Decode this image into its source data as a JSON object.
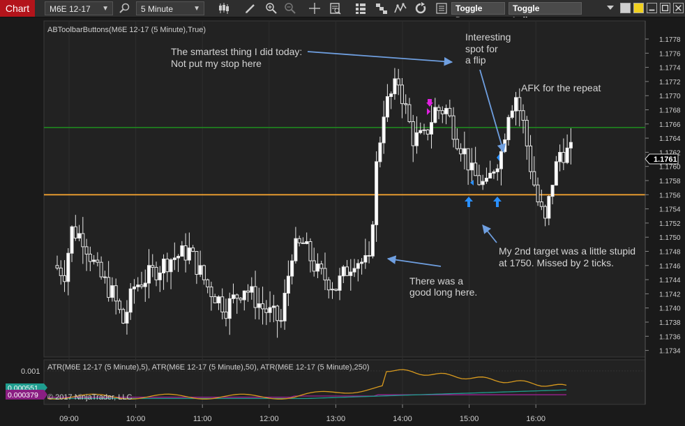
{
  "toolbar": {
    "chart_tab": "Chart",
    "instrument": "M6E 12-17",
    "interval": "5 Minute",
    "toggle_draw": "Toggle Draw",
    "toggle_indicators": "Toggle Indicators"
  },
  "chart": {
    "indicator_label": "ABToolbarButtons(M6E 12-17 (5 Minute),True)",
    "atr_label": "ATR(M6E 12-17 (5 Minute),5), ATR(M6E 12-17 (5 Minute),50), ATR(M6E 12-17 (5 Minute),250)",
    "copyright": "© 2017 NinjaTrader, LLC",
    "current_price": "1.1761",
    "atr_axis_label": "0.001",
    "atr_badge_1": "0.000551",
    "atr_badge_2": "0.000379",
    "price_ticks": [
      "1.1778",
      "1.1776",
      "1.1774",
      "1.1772",
      "1.1770",
      "1.1768",
      "1.1766",
      "1.1764",
      "1.1762",
      "1.1760",
      "1.1758",
      "1.1756",
      "1.1754",
      "1.1752",
      "1.1750",
      "1.1748",
      "1.1746",
      "1.1744",
      "1.1742",
      "1.1740",
      "1.1738",
      "1.1736",
      "1.1734"
    ],
    "time_ticks": [
      "09:00",
      "10:00",
      "11:00",
      "12:00",
      "13:00",
      "14:00",
      "15:00",
      "16:00"
    ],
    "green_line_price": 1.17655,
    "orange_line_price": 1.1756,
    "annotations": {
      "smartest_1": "The smartest thing I did today:",
      "smartest_2": "Not put my stop here",
      "interesting_1": "Interesting",
      "interesting_2": "spot for",
      "interesting_3": "a flip",
      "afk": "AFK for the repeat",
      "target_1": "My 2nd target was a little stupid",
      "target_2": "at 1750. Missed by 2 ticks.",
      "long_1": "There was a",
      "long_2": "good long here."
    },
    "colors": {
      "background": "#1a1a1a",
      "green_line": "#1f8f1f",
      "orange_line": "#f0a030",
      "arrow": "#6f9fe0",
      "atr_5": "#d89a1e",
      "atr_50": "#1f9d8f",
      "atr_250": "#9a2090"
    }
  }
}
